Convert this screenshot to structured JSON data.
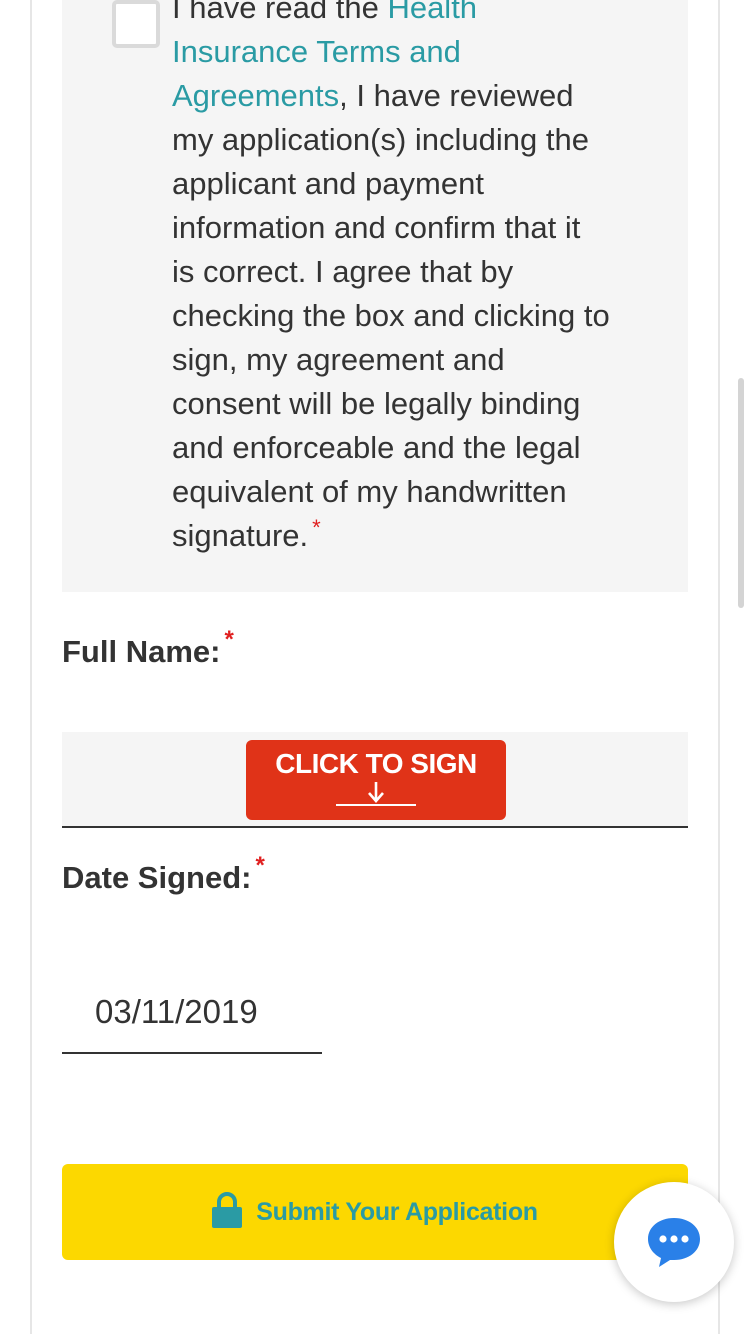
{
  "agreement": {
    "text_before_link": "I have read the ",
    "link_text": "Health Insurance Terms and Agreements",
    "text_after_link": ", I have reviewed my application(s) including the applicant and payment information and confirm that it is correct. I agree that by checking the box and clicking to sign, my agreement and consent will be legally binding and enforceable and the legal equivalent of my handwritten signature.",
    "required_mark": "*",
    "checked": false
  },
  "full_name": {
    "label": "Full Name:",
    "required_mark": "*",
    "sign_button_label": "CLICK TO SIGN"
  },
  "date_signed": {
    "label": "Date Signed:",
    "required_mark": "*",
    "value": "03/11/2019"
  },
  "submit": {
    "label": "Submit Your Application"
  },
  "icons": {
    "lock": "lock-icon",
    "chat": "chat-bubble-icon",
    "arrow": "arrow-down-icon"
  },
  "colors": {
    "accent_teal": "#2a9ba4",
    "sign_red": "#e03318",
    "submit_yellow": "#fcd800",
    "required_red": "#e02020"
  }
}
